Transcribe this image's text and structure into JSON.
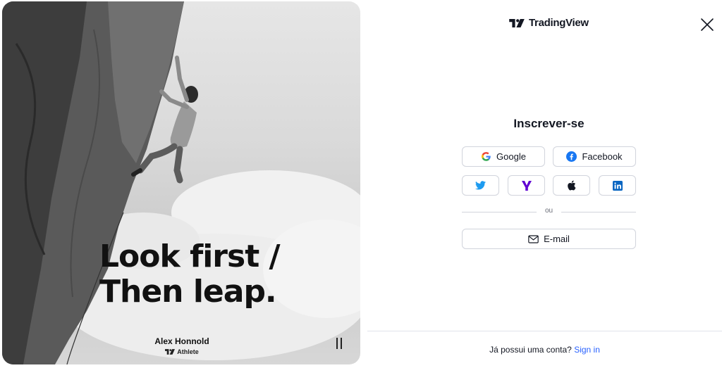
{
  "brand": {
    "name": "TradingView"
  },
  "hero": {
    "quote_line1": "Look first /",
    "quote_line2": "Then leap.",
    "athlete_name": "Alex Honnold",
    "athlete_role": "Athlete"
  },
  "signup": {
    "title": "Inscrever-se",
    "google_label": "Google",
    "facebook_label": "Facebook",
    "social_icons": [
      "twitter-icon",
      "yahoo-icon",
      "apple-icon",
      "linkedin-icon"
    ],
    "divider_text": "ou",
    "email_label": "E-mail"
  },
  "footer": {
    "question": "Já possui uma conta?",
    "signin_label": "Sign in"
  },
  "colors": {
    "link": "#2962ff",
    "facebook": "#1877f2",
    "twitter": "#1d9bf0",
    "yahoo": "#6001d2",
    "linkedin": "#0a66c2",
    "border": "#d1d4dc"
  }
}
